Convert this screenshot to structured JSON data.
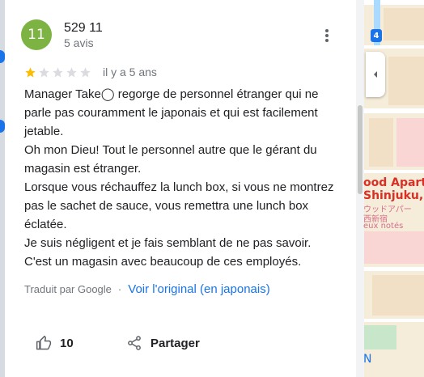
{
  "review": {
    "author": {
      "avatar_initials": "11",
      "name": "529 11",
      "meta": "5 avis",
      "avatar_color": "#7cb342"
    },
    "rating": 1,
    "rating_max": 5,
    "date": "il y a 5 ans",
    "lines": [
      "Manager Take◯ regorge de personnel étranger qui ne parle pas couramment le japonais et qui est facilement jetable.",
      "Oh mon Dieu! Tout le personnel autre que le gérant du magasin est étranger.",
      "Lorsque vous réchauffez la lunch box, si vous ne montrez pas le sachet de sauce, vous remettra une lunch box éclatée.",
      "Je suis négligent et je fais semblant de ne pas savoir.",
      "C'est un magasin avec beaucoup de ces employés."
    ],
    "translated_by": "Traduit par Google",
    "separator": "·",
    "see_original": "Voir l'original (en japonais)",
    "like_count": "10",
    "share_label": "Partager"
  },
  "map": {
    "metro_badge": "4",
    "labels": [
      "ood Apartm",
      "Shinjuku, T",
      "ウッドアパー",
      "西新宿",
      "eux notés",
      "N"
    ]
  },
  "colors": {
    "star_filled": "#fbbc04",
    "star_empty": "#dadce0",
    "link": "#1a73e8",
    "icon": "#5f6368"
  },
  "icons": {
    "more": "more-vert-icon",
    "like": "thumb-up-icon",
    "share": "share-icon",
    "collapse": "chevron-left-icon"
  }
}
